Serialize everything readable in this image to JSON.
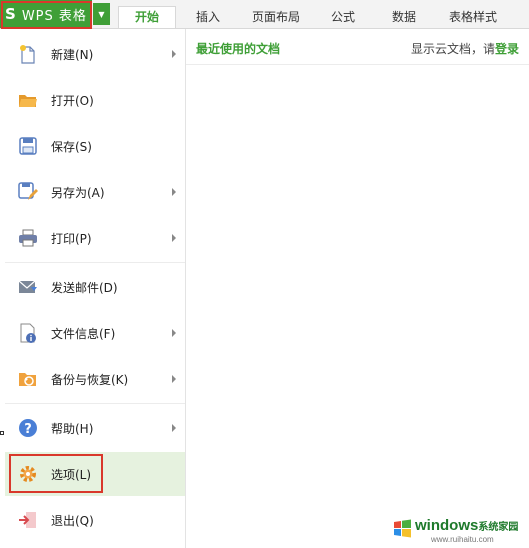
{
  "app": {
    "logo": "S",
    "title": "WPS 表格"
  },
  "tabs": [
    {
      "label": "开始",
      "active": true
    },
    {
      "label": "插入",
      "active": false
    },
    {
      "label": "页面布局",
      "active": false
    },
    {
      "label": "公式",
      "active": false
    },
    {
      "label": "数据",
      "active": false
    },
    {
      "label": "表格样式",
      "active": false
    }
  ],
  "menu": [
    {
      "label": "新建(N)",
      "icon": "new-file-icon",
      "submenu": true
    },
    {
      "label": "打开(O)",
      "icon": "folder-open-icon",
      "submenu": false
    },
    {
      "label": "保存(S)",
      "icon": "save-icon",
      "submenu": false
    },
    {
      "label": "另存为(A)",
      "icon": "save-as-icon",
      "submenu": true
    },
    {
      "label": "打印(P)",
      "icon": "printer-icon",
      "submenu": true
    },
    {
      "label": "发送邮件(D)",
      "icon": "mail-icon",
      "submenu": false
    },
    {
      "label": "文件信息(F)",
      "icon": "file-info-icon",
      "submenu": true
    },
    {
      "label": "备份与恢复(K)",
      "icon": "backup-icon",
      "submenu": true
    },
    {
      "label": "帮助(H)",
      "icon": "help-icon",
      "submenu": true
    },
    {
      "label": "选项(L)",
      "icon": "gear-icon",
      "submenu": false,
      "selected": true
    },
    {
      "label": "退出(Q)",
      "icon": "exit-icon",
      "submenu": false
    }
  ],
  "panel": {
    "recent_title": "最近使用的文档",
    "cloud_prefix": "显示云文档，请",
    "cloud_login": "登录"
  },
  "watermark": {
    "brand": "windows",
    "brand_suffix": "系统家园",
    "url": "www.ruihaitu.com"
  },
  "colors": {
    "accent": "#3f9f37",
    "highlight_outline": "#d9382b",
    "selected_bg": "#e6f2df"
  }
}
